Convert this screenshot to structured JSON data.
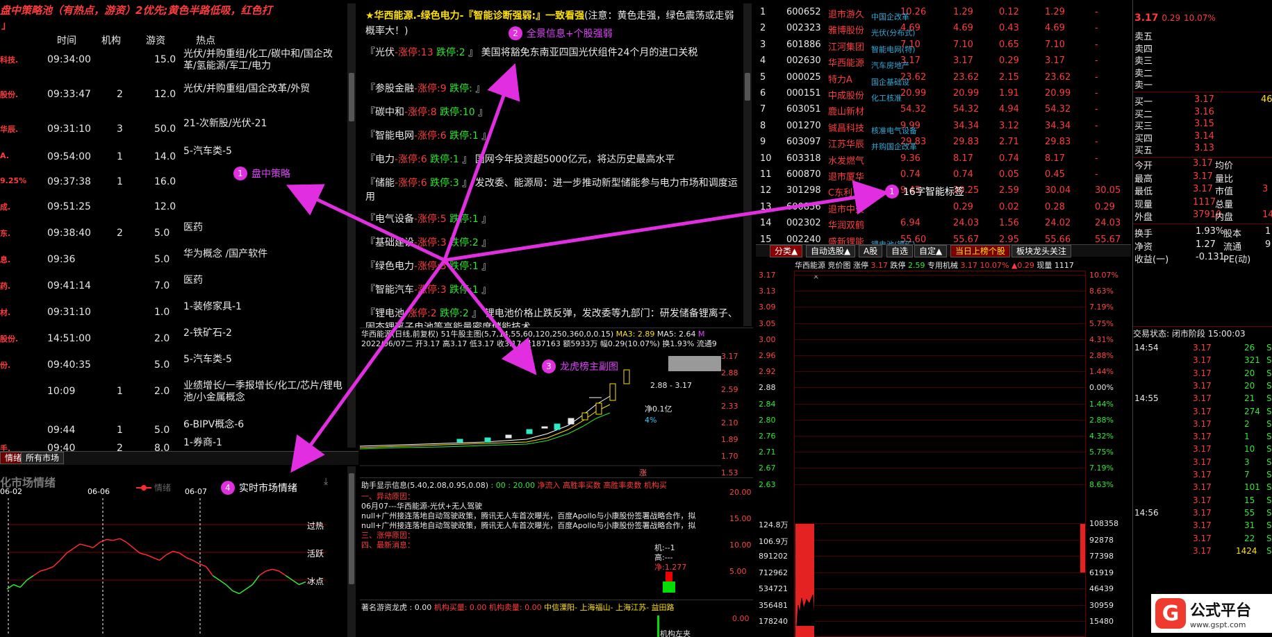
{
  "strategy": {
    "title": "盘中策略池（有热点，游资）2优先;黄色半路低吸，红色打",
    "title2": "」",
    "headers": [
      "时间",
      "机构",
      "游资",
      "热点"
    ],
    "rows": [
      {
        "stock": "科技.",
        "time": "09:34:00",
        "inst": "",
        "hot": "15.0",
        "topic": "光伏/并购重组/化工/碳中和/国企改革/氢能源/军工/电力"
      },
      {
        "stock": "股份.",
        "time": "09:33:47",
        "inst": "2",
        "hot": "12.0",
        "topic": "光伏/并购重组/国企改革/外贸"
      },
      {
        "stock": "华辰.",
        "time": "09:31:10",
        "inst": "3",
        "hot": "50.0",
        "topic": "21-次新股/光伏-21"
      },
      {
        "stock": "A.",
        "time": "09:54:00",
        "inst": "1",
        "hot": "14.0",
        "topic": "5-汽车类-5"
      },
      {
        "stock": "9.25%",
        "time": "09:37:38",
        "inst": "1",
        "hot": "16.0",
        "topic": ""
      },
      {
        "stock": "成.",
        "time": "09:51:25",
        "inst": "",
        "hot": "12.0",
        "topic": ""
      },
      {
        "stock": "东.",
        "time": "09:38:40",
        "inst": "2",
        "hot": "5.0",
        "topic": "医药"
      },
      {
        "stock": "息.",
        "time": "09:36",
        "inst": "",
        "hot": "5.0",
        "topic": "华为概念 /国产软件"
      },
      {
        "stock": "药.",
        "time": "09:41:14",
        "inst": "",
        "hot": "7.0",
        "topic": "医药"
      },
      {
        "stock": "材.",
        "time": "09:31:10",
        "inst": "",
        "hot": "1.0",
        "topic": "1-装修家具-1"
      },
      {
        "stock": "股份.",
        "time": "14:51:00",
        "inst": "",
        "hot": "2.0",
        "topic": "2-铁矿石-2"
      },
      {
        "stock": "份.",
        "time": "09:40:35",
        "inst": "",
        "hot": "5.0",
        "topic": "5-汽车类-5"
      },
      {
        "stock": "",
        "time": "10:09",
        "inst": "1",
        "hot": "2.0",
        "topic": "业绩增长/一季报增长/化工/芯片/锂电池/小金属概念"
      },
      {
        "stock": "",
        "time": "09:44",
        "inst": "1",
        "hot": "5.0",
        "topic": "6-BIPV概念-6"
      },
      {
        "stock": "手.",
        "time": "09:40",
        "inst": "2",
        "hot": "8.0",
        "topic": "1-券商-1"
      }
    ]
  },
  "mood": {
    "tab1": "情绪",
    "tab2": "所有市场",
    "title": "化市场情绪",
    "legend": "情绪",
    "dates": [
      "06-02",
      "06-06",
      "06-07"
    ],
    "levels": [
      "过热",
      "活跃",
      "冰点"
    ],
    "series": [
      -0.1,
      -0.05,
      -0.08,
      0.0,
      0.05,
      0.1,
      0.12,
      0.15,
      0.22,
      0.3,
      0.35,
      0.4,
      0.38,
      0.36,
      0.42,
      0.45,
      0.44,
      0.46,
      0.42,
      0.36,
      0.3,
      0.28,
      0.25,
      0.22,
      0.28,
      0.32,
      0.3,
      0.25,
      0.22,
      0.18,
      0.15,
      0.05,
      0.0,
      -0.05,
      -0.12,
      -0.15,
      -0.1,
      -0.05,
      0.05,
      0.1,
      0.12,
      0.1,
      0.05,
      0.0,
      -0.05,
      -0.02
    ]
  },
  "news": {
    "header": "★华西能源.-绿色电力-『智能诊断强弱:』一致看强",
    "note": "(注意：黄色走强，绿色震荡或走弱概率大！)",
    "items": [
      {
        "name": "光伏",
        "up": "13",
        "down": "2",
        "text": "美国将豁免东南亚四国光伏组件24个月的进口关税"
      },
      {
        "name": "参股金融",
        "up": "9",
        "down": "",
        "text": ""
      },
      {
        "name": "碳中和",
        "up": "8",
        "down": "10",
        "text": ""
      },
      {
        "name": "智能电网",
        "up": "6",
        "down": "1",
        "text": ""
      },
      {
        "name": "电力",
        "up": "6",
        "down": "1",
        "text": "国网今年投资超5000亿元，将达历史最高水平"
      },
      {
        "name": "储能",
        "up": "6",
        "down": "3",
        "text": "发改委、能源局：进一步推动新型储能参与电力市场和调度运用"
      },
      {
        "name": "电气设备",
        "up": "5",
        "down": "1",
        "text": ""
      },
      {
        "name": "基础建设",
        "up": "3",
        "down": "2",
        "text": ""
      },
      {
        "name": "绿色电力",
        "up": "3",
        "down": "1",
        "text": ""
      },
      {
        "name": "智能汽车",
        "up": "3",
        "down": "1",
        "text": ""
      },
      {
        "name": "锂电池",
        "up": "2",
        "down": "2",
        "text": "锂电池价格止跌反弹，发改委等九部门：研发储备锂离子、固态锂离子电池等高能量密度储能技术"
      }
    ],
    "label_up": "涨停:",
    "label_down": "跌停:"
  },
  "kline": {
    "title": "华西能源(日线,前复权)",
    "indicator": "51牛股主图(5,7,14,55,60,120,250,360,0,0.15)",
    "ma3": "MA3: 2.89",
    "ma5": "MA5: 2.64",
    "m": "M",
    "info": "2022/06/07二 开3.17 高3.17 低3.17 收3.17 量187163 额5933万 幅0.29(10.07%) 换1.93% 流通9",
    "axis": [
      "3.17",
      "2.88",
      "2.59",
      "2.33",
      "2.10",
      "1.89",
      "1.70",
      "1.53"
    ],
    "rng": "2.88 - 3.17",
    "net": "净0.1亿",
    "pct": "4%",
    "zhang": "涨"
  },
  "helper": {
    "header": "助手显示信息(5.40,2.08,0.95,0.08)",
    "t1": ": 00 : 20.00",
    "inflow": "净流入",
    "high1": "高胜率买数",
    "high2": "高胜率卖数",
    "inst": "机构买",
    "l1": "一、异动原因：",
    "l2": "06月07---华西能源-光伏+无人驾驶",
    "l3": "null+广州接连落地自动驾驶政策，腾讯无人车首次曝光，百度Apollo与小康股份签署战略合作，拟",
    "l4": "null+广州接连落地自动驾驶政策，腾讯无人车首次曝光，百度Apollo与小康股份签署战略合作，拟",
    "l5": "三、涨停原因：",
    "l6": "四、最新消息：",
    "axis": [
      "20.00",
      "15.00",
      "10.00",
      "5.00"
    ],
    "ji": "机:--1",
    "gao": "高:---",
    "jing": "净:1.277"
  },
  "dragon": {
    "header": "著名游资龙虎",
    "vals": ": 0.00",
    "buy": "机构买量: 0.00",
    "sell": "机构卖量: 0.00",
    "c1": "中信溧阳-",
    "c2": "上海福山-",
    "c3": "上海江苏-",
    "c4": "益田路",
    "axis": "0.00",
    "tag": "机构左夹"
  },
  "ranks": [
    {
      "n": "1",
      "code": "600652",
      "name": "退市游久",
      "p": "10.26",
      "c": "1.29",
      "d": "0.12",
      "v": "1.29",
      "e": "-",
      "tag": "中国企改革"
    },
    {
      "n": "2",
      "code": "002323",
      "name": "雅博股份",
      "p": "4.69",
      "c": "4.69",
      "d": "0.43",
      "v": "4.69",
      "e": "-",
      "tag": "光伏(分布式)"
    },
    {
      "n": "3",
      "code": "601886",
      "name": "江河集团",
      "p": "7.10",
      "c": "7.10",
      "d": "0.65",
      "v": "7.10",
      "e": "-",
      "tag": "智能电网(特)"
    },
    {
      "n": "4",
      "code": "002630",
      "name": "华西能源",
      "p": "3.17",
      "c": "3.17",
      "d": "0.29",
      "v": "3.17",
      "e": "-",
      "tag": "汽车房地产"
    },
    {
      "n": "5",
      "code": "000025",
      "name": "特力A",
      "p": "23.62",
      "c": "23.62",
      "d": "2.15",
      "v": "23.62",
      "e": "-",
      "tag": "国企基础设"
    },
    {
      "n": "6",
      "code": "000151",
      "name": "中成股份",
      "p": "20.99",
      "c": "20.99",
      "d": "1.91",
      "v": "20.99",
      "e": "-",
      "tag": "化工核准"
    },
    {
      "n": "7",
      "code": "603051",
      "name": "鹿山新材",
      "p": "54.32",
      "c": "54.32",
      "d": "4.94",
      "v": "54.32",
      "e": "-",
      "tag": ""
    },
    {
      "n": "8",
      "code": "001270",
      "name": "铖昌科技",
      "p": "9.99",
      "c": "34.34",
      "d": "3.12",
      "v": "34.34",
      "e": "-",
      "tag": "核准电气设备"
    },
    {
      "n": "9",
      "code": "603097",
      "name": "江苏华辰",
      "p": "29.83",
      "c": "29.83",
      "d": "2.71",
      "v": "29.83",
      "e": "-",
      "tag": "并购国企改革"
    },
    {
      "n": "10",
      "code": "603318",
      "name": "水发燃气",
      "p": "9.36",
      "c": "8.17",
      "d": "0.74",
      "v": "8.17",
      "e": "-",
      "tag": ""
    },
    {
      "n": "11",
      "code": "600870",
      "name": "退市厦华",
      "p": "0.74",
      "c": "0.74",
      "d": "0.05",
      "v": "0.45",
      "e": "-",
      "tag": ""
    },
    {
      "n": "12",
      "code": "301298",
      "name": "C东利",
      "p": "9.43",
      "c": "30.25",
      "d": "2.59",
      "v": "30.04",
      "e": "30.05",
      "tag": ""
    },
    {
      "n": "13",
      "code": "600856",
      "name": "退市中天",
      "p": "",
      "c": "0.29",
      "d": "0.02",
      "v": "0.28",
      "e": "0.29",
      "tag": ""
    },
    {
      "n": "14",
      "code": "002302",
      "name": "华润双鹤",
      "p": "6.94",
      "c": "24.03",
      "d": "1.56",
      "v": "24.02",
      "e": "24.03",
      "tag": ""
    },
    {
      "n": "15",
      "code": "002240",
      "name": "盛新锂能",
      "p": "55.60",
      "c": "55.67",
      "d": "2.95",
      "v": "55.66",
      "e": "55.67",
      "tag": "锂电池(锂矿)"
    }
  ],
  "rtabs": [
    "分类▲",
    "自动选股▲",
    "A股",
    "自选",
    "自定▲",
    "当日上榜个股",
    "板块龙头关注"
  ],
  "intraday": {
    "name": "华西能源",
    "tabs": "竞价图 涨停",
    "zt": "3.17",
    "dt": "2.59",
    "lbl": "专用机械",
    "lp": "3.17",
    "pct": "10.07%",
    "chg": "▲0.29",
    "now": "现量 1117",
    "left": [
      "3.17",
      "3.13",
      "3.09",
      "3.05",
      "3.00",
      "2.96",
      "2.92",
      "2.88",
      "2.84",
      "2.80",
      "2.76",
      "2.71",
      "2.67",
      "2.63"
    ],
    "right": [
      "10.07%",
      "8.63%",
      "7.19%",
      "5.75%",
      "4.31%",
      "2.88%",
      "1.44%",
      "0.00%",
      "1.44%",
      "2.88%",
      "4.32%",
      "5.75%",
      "7.19%",
      "8.63%"
    ],
    "vleft": [
      "124.8万",
      "106.9万",
      "891202",
      "712962",
      "534721",
      "356481",
      "178240"
    ],
    "vright": [
      "108358",
      "92878",
      "77398",
      "61919",
      "46439",
      "30959",
      "15480"
    ]
  },
  "quote": {
    "price": "3.17",
    "chg": "0.29",
    "pct": "10.07%",
    "sell": [
      "卖五",
      "卖四",
      "卖三",
      "卖二",
      "卖一"
    ],
    "buy": [
      {
        "l": "买一",
        "p": "3.17",
        "v": "46"
      },
      {
        "l": "买二",
        "p": "3.16",
        "v": ""
      },
      {
        "l": "买三",
        "p": "3.15",
        "v": ""
      },
      {
        "l": "买四",
        "p": "3.14",
        "v": ""
      },
      {
        "l": "买五",
        "p": "3.13",
        "v": ""
      }
    ],
    "stats": [
      {
        "a": "今开",
        "b": "3.17",
        "c": "均价",
        "d": ""
      },
      {
        "a": "最高",
        "b": "3.17",
        "c": "量比",
        "d": ""
      },
      {
        "a": "最低",
        "b": "3.17",
        "c": "市值",
        "d": "3"
      },
      {
        "a": "现量",
        "b": "1117",
        "c": "总量",
        "d": ""
      },
      {
        "a": "外盘",
        "b": "37910",
        "c": "内盘",
        "d": "14"
      }
    ],
    "stats2": [
      {
        "a": "换手",
        "b": "1.93%",
        "c": "股本",
        "d": "1"
      },
      {
        "a": "净资",
        "b": "1.27",
        "c": "流通",
        "d": "9"
      },
      {
        "a": "收益(一)",
        "b": "-0.131",
        "c": "PE(动)",
        "d": ""
      }
    ],
    "state": "交易状态: 闭市阶段",
    "time": "15:00:03",
    "ticks": [
      {
        "t": "14:54",
        "p": "3.17",
        "v": "26",
        "s": "S"
      },
      {
        "t": "",
        "p": "3.17",
        "v": "321",
        "s": "S"
      },
      {
        "t": "",
        "p": "3.17",
        "v": "20",
        "s": "S"
      },
      {
        "t": "",
        "p": "3.17",
        "v": "20",
        "s": "S"
      },
      {
        "t": "14:55",
        "p": "3.17",
        "v": "21",
        "s": "S"
      },
      {
        "t": "",
        "p": "3.17",
        "v": "274",
        "s": "S"
      },
      {
        "t": "",
        "p": "3.17",
        "v": "2",
        "s": "S"
      },
      {
        "t": "",
        "p": "3.17",
        "v": "1",
        "s": "S"
      },
      {
        "t": "",
        "p": "3.17",
        "v": "10",
        "s": "S"
      },
      {
        "t": "",
        "p": "3.17",
        "v": "3",
        "s": "S"
      },
      {
        "t": "",
        "p": "3.17",
        "v": "7",
        "s": "S"
      },
      {
        "t": "",
        "p": "3.17",
        "v": "101",
        "s": "S"
      },
      {
        "t": "",
        "p": "3.17",
        "v": "15",
        "s": "S"
      },
      {
        "t": "14:56",
        "p": "3.17",
        "v": "55",
        "s": "S"
      },
      {
        "t": "",
        "p": "3.17",
        "v": "31",
        "s": "S"
      },
      {
        "t": "",
        "p": "3.17",
        "v": "22",
        "s": "S"
      },
      {
        "t": "",
        "p": "3.17",
        "v": "1424",
        "s": "S"
      }
    ]
  },
  "annotations": {
    "a1": "盘中策略",
    "a2": "全景信息+个股强弱",
    "a3": "龙虎榜主副图",
    "a4": "实时市场情绪",
    "a5": "16字智能标签",
    "n1": "1",
    "n2": "2",
    "n3": "3",
    "n4": "4",
    "n5": "1"
  },
  "logo": {
    "text": "公式平台",
    "url": "www.gspt.com"
  }
}
